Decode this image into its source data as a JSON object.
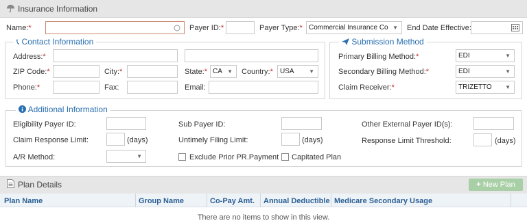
{
  "header": {
    "title": "Insurance Information",
    "icon": "umbrella-icon"
  },
  "top_row": {
    "name_label": "Name:",
    "name_value": "",
    "payer_id_label": "Payer ID:",
    "payer_id_value": "",
    "payer_type_label": "Payer Type:",
    "payer_type_value": "Commercial Insurance Co",
    "end_date_label": "End Date Effective:",
    "end_date_value": "",
    "required_mark": "*"
  },
  "contact": {
    "legend": "Contact Information",
    "icon": "phone-icon",
    "address_label": "Address:",
    "zip_label": "ZIP Code:",
    "city_label": "City:",
    "state_label": "State:",
    "state_value": "CA",
    "country_label": "Country:",
    "country_value": "USA",
    "phone_label": "Phone:",
    "fax_label": "Fax:",
    "email_label": "Email:"
  },
  "submission": {
    "legend": "Submission Method",
    "icon": "paper-plane-icon",
    "primary_label": "Primary Billing Method:",
    "primary_value": "EDI",
    "secondary_label": "Secondary Billing Method:",
    "secondary_value": "EDI",
    "receiver_label": "Claim Receiver:",
    "receiver_value": "TRIZETTO"
  },
  "additional": {
    "legend": "Additional Information",
    "icon": "info-icon",
    "eligibility_label": "Eligibility Payer ID:",
    "sub_payer_label": "Sub Payer ID:",
    "other_external_label": "Other External Payer ID(s):",
    "claim_response_label": "Claim Response Limit:",
    "untimely_label": "Untimely Filing Limit:",
    "response_threshold_label": "Response Limit Threshold:",
    "days_label": "(days)",
    "ar_method_label": "A/R Method:",
    "exclude_label": "Exclude Prior PR.Payment",
    "capitated_label": "Capitated Plan"
  },
  "plans": {
    "title": "Plan Details",
    "icon": "document-icon",
    "new_plan_label": "New Plan",
    "columns": [
      "Plan Name",
      "Group Name",
      "Co-Pay Amt.",
      "Annual Deductible",
      "Medicare Secondary Usage"
    ],
    "empty_message": "There are no items to show in this view."
  },
  "colors": {
    "accent": "#2a6fb0",
    "required": "#c0262d",
    "header_bg": "#e6e6e6",
    "new_plan_bg": "#a9cfa6"
  }
}
